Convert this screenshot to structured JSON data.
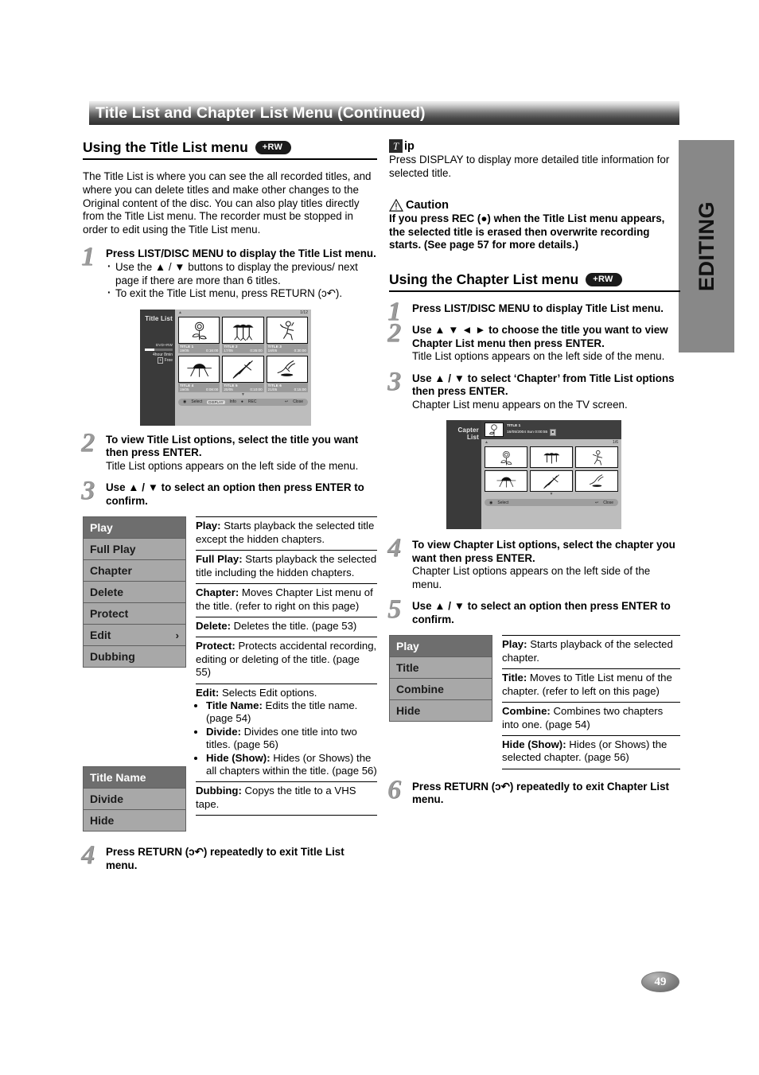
{
  "page": {
    "title": "Title List and Chapter List Menu (Continued)",
    "side_tab": "EDITING",
    "page_number": "49"
  },
  "left": {
    "section": {
      "heading": "Using the Title List menu",
      "badge": "+RW"
    },
    "intro": "The Title List is where you can see the all recorded titles, and where you can delete titles and make other changes to the Original content of the disc. You can also play titles directly from the Title List menu. The recorder must be stopped in order to edit using the Title List menu.",
    "steps": [
      {
        "num": "1",
        "head": "Press LIST/DISC MENU to display the Title List menu.",
        "bullets": [
          "Use the ▲ / ▼ buttons to display the previous/ next page if there are more than 6 titles.",
          "To exit the Title List menu, press RETURN (ɔ↶)."
        ]
      },
      {
        "num": "2",
        "head": "To view Title List options, select the title you want then press ENTER.",
        "sub": "Title List options appears on the left side of the menu."
      },
      {
        "num": "3",
        "head": "Use ▲ / ▼ to select an option then press ENTER to confirm."
      },
      {
        "num": "4",
        "head": "Press RETURN (ɔ↶) repeatedly to exit Title List menu."
      }
    ],
    "tv_screen": {
      "label": "Title List",
      "disc_type": "DVD+RW",
      "free_line1": "4hour 8min",
      "free_line2": "Free",
      "page_indicator": "1/12",
      "items": [
        {
          "title": "TITLE 1",
          "date": "19/05",
          "time": "0:16:00"
        },
        {
          "title": "TITLE 2",
          "date": "17/05",
          "time": "0:35:00"
        },
        {
          "title": "TITLE 3",
          "date": "18/05",
          "time": "0:30:00"
        },
        {
          "title": "TITLE 4",
          "date": "19/05",
          "time": "0:08:00"
        },
        {
          "title": "TITLE 5",
          "date": "20/05",
          "time": "0:10:00"
        },
        {
          "title": "TITLE 6",
          "date": "21/05",
          "time": "0:15:00"
        }
      ],
      "bottom_bar": {
        "select": "Select",
        "display_key": "DISPLAY",
        "info": "Info",
        "rec": "REC",
        "close": "Close"
      }
    },
    "options": [
      {
        "label": "Play",
        "selected": true
      },
      {
        "label": "Full Play",
        "selected": false
      },
      {
        "label": "Chapter",
        "selected": false
      },
      {
        "label": "Delete",
        "selected": false
      },
      {
        "label": "Protect",
        "selected": false
      },
      {
        "label": "Edit",
        "selected": false,
        "arrow": "›"
      },
      {
        "label": "Dubbing",
        "selected": false
      }
    ],
    "sub_options": [
      {
        "label": "Title Name",
        "selected": true
      },
      {
        "label": "Divide",
        "selected": false
      },
      {
        "label": "Hide",
        "selected": false
      }
    ],
    "descriptions": [
      {
        "term": "Play:",
        "text": " Starts playback the selected title except the hidden chapters."
      },
      {
        "term": "Full Play:",
        "text": " Starts playback the selected title including the hidden chapters."
      },
      {
        "term": "Chapter:",
        "text": " Moves Chapter List menu of the title. (refer to right on this page)"
      },
      {
        "term": "Delete:",
        "text": " Deletes the title. (page 53)"
      },
      {
        "term": "Protect:",
        "text": " Protects accidental recording, editing or deleting of the title. (page 55)"
      }
    ],
    "edit_desc": {
      "term": "Edit:",
      "text": " Selects Edit options.",
      "items": [
        {
          "term": "Title Name:",
          "text": " Edits the title name. (page 54)"
        },
        {
          "term": "Divide:",
          "text": " Divides one title into two titles. (page 56)"
        },
        {
          "term": "Hide (Show):",
          "text": " Hides (or Shows) the all chapters within the title. (page 56)"
        }
      ]
    },
    "dubbing_desc": {
      "term": "Dubbing:",
      "text": " Copys the title to a VHS tape."
    }
  },
  "right": {
    "tip": {
      "glyph": "T",
      "word": "ip",
      "text": "Press DISPLAY to display more detailed title information for selected title."
    },
    "caution": {
      "word": "Caution",
      "text": "If you press REC (●) when the Title List menu appears, the selected title is erased then overwrite recording starts. (See page 57 for more details.)"
    },
    "section": {
      "heading": "Using the Chapter List menu",
      "badge": "+RW"
    },
    "steps": [
      {
        "num": "1",
        "head": "Press LIST/DISC MENU to display Title List menu."
      },
      {
        "num": "2",
        "head": "Use ▲ ▼ ◄ ► to choose the title you want to view Chapter List menu then press ENTER.",
        "sub": "Title List options appears on the left side of the menu."
      },
      {
        "num": "3",
        "head": "Use ▲ / ▼ to select ‘Chapter’ from Title List options then press ENTER.",
        "sub": "Chapter List menu appears on the TV screen."
      },
      {
        "num": "4",
        "head": "To view Chapter List options, select the chapter you want then press ENTER.",
        "sub": "Chapter List options appears on the left side of the menu."
      },
      {
        "num": "5",
        "head": "Use ▲ / ▼ to select an option then press ENTER to confirm."
      },
      {
        "num": "6",
        "head": "Press RETURN (ɔ↶) repeatedly to exit Chapter List menu."
      }
    ],
    "tv_screen": {
      "label": "Capter List",
      "title_name": "TITLE 1",
      "title_info": "16/05/2004 Sun 0:00:55",
      "page_indicator": "1/6",
      "bottom_bar": {
        "select": "Select",
        "close": "Close"
      }
    },
    "options": [
      {
        "label": "Play",
        "selected": true
      },
      {
        "label": "Title",
        "selected": false
      },
      {
        "label": "Combine",
        "selected": false
      },
      {
        "label": "Hide",
        "selected": false
      }
    ],
    "descriptions": [
      {
        "term": "Play:",
        "text": " Starts playback of the selected chapter."
      },
      {
        "term": "Title:",
        "text": " Moves to Title List menu of the chapter. (refer to left on this page)"
      },
      {
        "term": "Combine:",
        "text": " Combines two chapters into one. (page 54)"
      },
      {
        "term": "Hide (Show):",
        "text": " Hides (or Shows) the selected chapter. (page 56)"
      }
    ]
  },
  "icons": {
    "thumb_rose": "rose-thumbnail",
    "thumb_dancers": "dancers-thumbnail",
    "thumb_figure": "figure-thumbnail",
    "thumb_car": "car-thumbnail",
    "thumb_shuttle": "shuttle-thumbnail",
    "thumb_bird": "bird-thumbnail"
  },
  "colors": {
    "accent": "#6e6e6e",
    "option_bg": "#a8a8a8",
    "tv_bg": "#3f3f3f"
  }
}
